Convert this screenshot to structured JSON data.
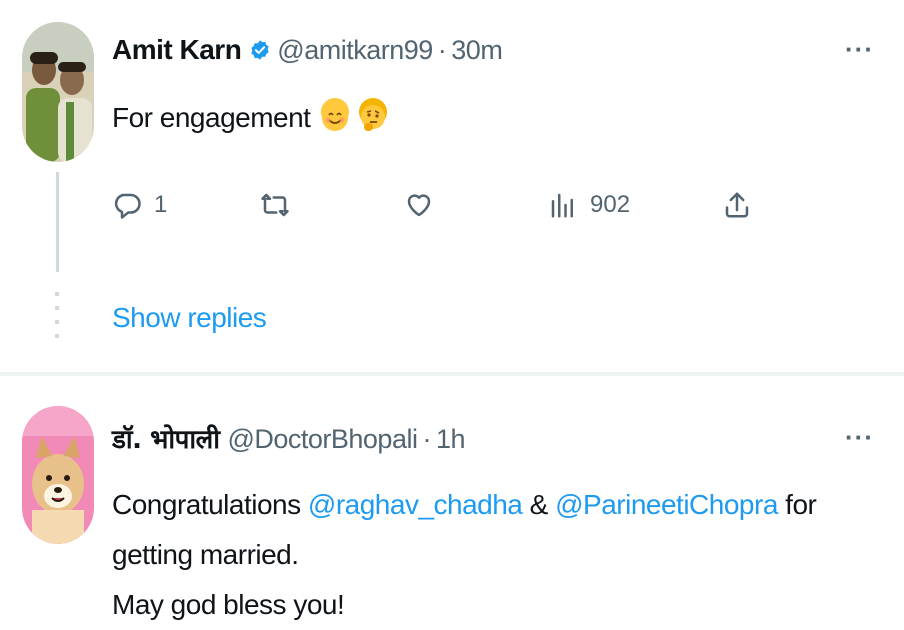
{
  "tweets": [
    {
      "name": "Amit Karn",
      "handle": "@amitkarn99",
      "dot": "·",
      "time": "30m",
      "text": "For engagement",
      "emojis": [
        "smiling-face-icon",
        "thinking-face-icon"
      ],
      "actions": {
        "reply_count": "1",
        "retweet_count": "",
        "like_count": "",
        "views_count": "902"
      },
      "show_replies": "Show replies",
      "verified": true
    },
    {
      "name": "डॉ. भोपाली",
      "handle": "@DoctorBhopali",
      "dot": "·",
      "time": "1h",
      "text_parts": {
        "p1": "Congratulations ",
        "m1": "@raghav_chadha",
        "p2": " & ",
        "m2": "@ParineetiChopra",
        "p3": " for getting married.",
        "line2": "May god bless you!"
      }
    }
  ],
  "more_label": "···",
  "colors": {
    "accent": "#1d9bf0",
    "secondary_text": "#536471",
    "divider": "#eff3f4"
  }
}
